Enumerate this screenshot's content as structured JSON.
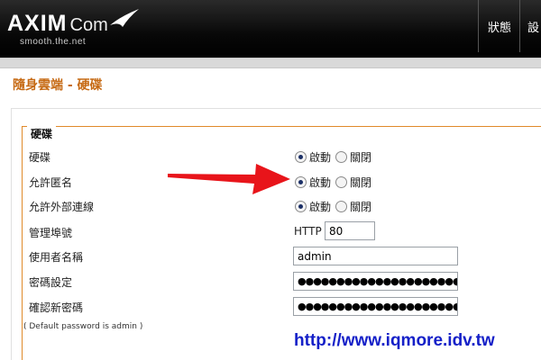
{
  "header": {
    "logo_main": "AXIM",
    "logo_com": "Com",
    "logo_tagline": "smooth.the.net",
    "nav": [
      {
        "label": "狀態"
      },
      {
        "label": "設"
      }
    ]
  },
  "page_title": "隨身雲端 - 硬碟",
  "form": {
    "legend": "硬碟",
    "rows": [
      {
        "label": "硬碟",
        "options": [
          "啟動",
          "關閉"
        ],
        "selected": "啟動"
      },
      {
        "label": "允許匿名",
        "options": [
          "啟動",
          "關閉"
        ],
        "selected": "啟動"
      },
      {
        "label": "允許外部連線",
        "options": [
          "啟動",
          "關閉"
        ],
        "selected": "啟動"
      }
    ],
    "port_label": "管理埠號",
    "port_prefix": "HTTP",
    "port_value": "80",
    "username_label": "使用者名稱",
    "username_value": "admin",
    "password_label": "密碼設定",
    "password_value": "●●●●●●●●●●●●●●●●●●●●●●●●●●●●●●●●",
    "confirm_label": "確認新密碼",
    "confirm_value": "●●●●●●●●●●●●●●●●●●●●●●●●●●●●●●●●",
    "note": "( Default password is admin )"
  },
  "watermark": "http://www.iqmore.idv.tw",
  "colors": {
    "title": "#c66a14",
    "fieldset_border": "#e08a2a",
    "watermark": "#1520c8",
    "arrow": "#e8141a"
  }
}
